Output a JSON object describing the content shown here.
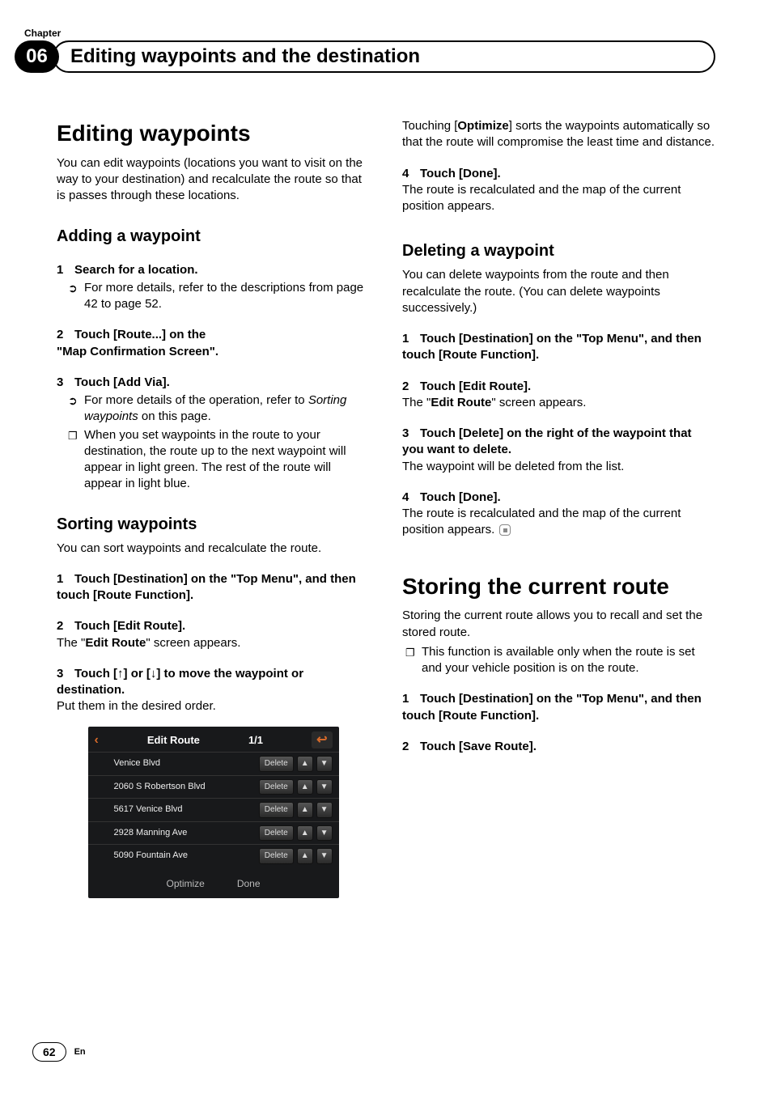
{
  "header": {
    "chapter_label": "Chapter",
    "chapter_number": "06",
    "title": "Editing waypoints and the destination"
  },
  "left": {
    "h1": "Editing waypoints",
    "intro": "You can edit waypoints (locations you want to visit on the way to your destination) and recalculate the route so that is passes through these locations.",
    "adding": {
      "heading": "Adding a waypoint",
      "step1": "Search for a location.",
      "step1_note": "For more details, refer to the descriptions from page 42 to page 52.",
      "step2_line1": "Touch [Route...] on the",
      "step2_line2": "\"Map Confirmation Screen\".",
      "step3": "Touch [Add Via].",
      "step3_note1_a": "For more details of the operation, refer to ",
      "step3_note1_b": "Sorting waypoints",
      "step3_note1_c": " on this page.",
      "step3_note2": "When you set waypoints in the route to your destination, the route up to the next waypoint will appear in light green. The rest of the route will appear in light blue."
    },
    "sorting": {
      "heading": "Sorting waypoints",
      "intro": "You can sort waypoints and recalculate the route.",
      "step1": "Touch [Destination] on the \"Top Menu\", and then touch [Route Function].",
      "step2": "Touch [Edit Route].",
      "step2_note_a": "The \"",
      "step2_note_b": "Edit Route",
      "step2_note_c": "\" screen appears.",
      "step3_a": "Touch [",
      "step3_b": "] or [",
      "step3_c": "] to move the waypoint or destination.",
      "step3_note": "Put them in the desired order."
    },
    "screenshot": {
      "title": "Edit Route",
      "page_ind": "1/1",
      "rows": [
        "Venice Blvd",
        "2060 S Robertson Blvd",
        "5617 Venice Blvd",
        "2928 Manning Ave",
        "5090 Fountain Ave"
      ],
      "delete_label": "Delete",
      "optimize": "Optimize",
      "done": "Done"
    }
  },
  "right": {
    "optimize_note_a": "Touching [",
    "optimize_note_b": "Optimize",
    "optimize_note_c": "] sorts the waypoints automatically so that the route will compromise the least time and distance.",
    "step4": "Touch [Done].",
    "step4_note": "The route is recalculated and the map of the current position appears.",
    "deleting": {
      "heading": "Deleting a waypoint",
      "intro": "You can delete waypoints from the route and then recalculate the route. (You can delete waypoints successively.)",
      "step1": "Touch [Destination] on the \"Top Menu\", and then touch [Route Function].",
      "step2": "Touch [Edit Route].",
      "step2_note_a": "The \"",
      "step2_note_b": "Edit Route",
      "step2_note_c": "\" screen appears.",
      "step3": "Touch [Delete] on the right of the waypoint that you want to delete.",
      "step3_note": "The waypoint will be deleted from the list.",
      "step4": "Touch [Done].",
      "step4_note": "The route is recalculated and the map of the current position appears."
    },
    "storing": {
      "heading": "Storing the current route",
      "intro": "Storing the current route allows you to recall and set the stored route.",
      "bullet": "This function is available only when the route is set and your vehicle position is on the route.",
      "step1": "Touch [Destination] on the \"Top Menu\", and then touch [Route Function].",
      "step2": "Touch [Save Route]."
    }
  },
  "footer": {
    "page": "62",
    "lang": "En"
  }
}
